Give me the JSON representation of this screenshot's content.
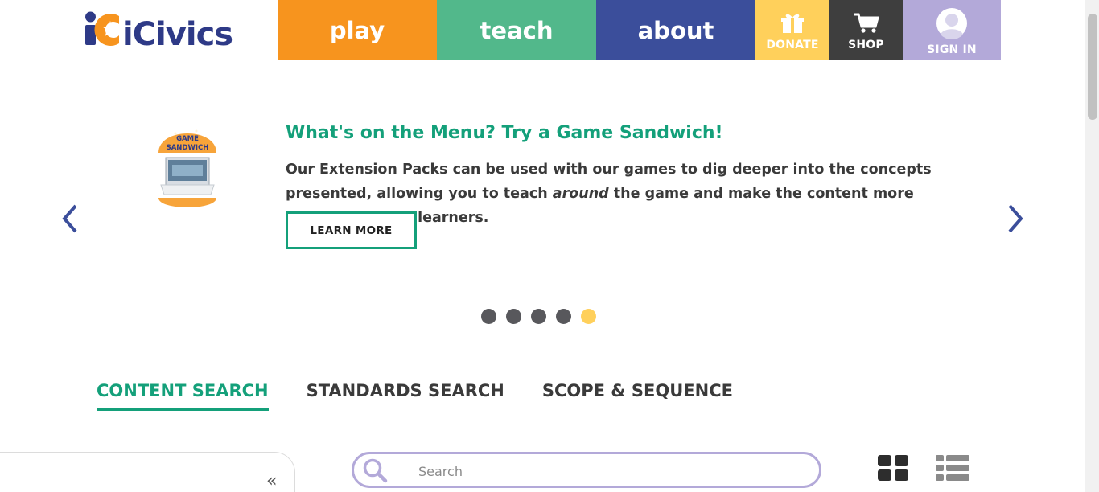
{
  "header": {
    "logo_text": "iCivics",
    "nav": {
      "play": "play",
      "teach": "teach",
      "about": "about",
      "donate": "DONATE",
      "shop": "SHOP",
      "sign_in": "SIGN IN"
    }
  },
  "carousel": {
    "image_caption": "GAME SANDWICH",
    "title": "What's on the Menu? Try a Game Sandwich!",
    "text_part1": "Our Extension Packs can be used with our games to dig deeper into the concepts presented, allowing you to teach ",
    "text_emphasis": "around",
    "text_part2": " the game and make the content more accessible to all learners.",
    "button_label": "LEARN MORE",
    "slide_count": 5,
    "active_slide": 5
  },
  "tabs": [
    {
      "label": "CONTENT SEARCH",
      "active": true
    },
    {
      "label": "STANDARDS SEARCH",
      "active": false
    },
    {
      "label": "SCOPE & SEQUENCE",
      "active": false
    }
  ],
  "search": {
    "placeholder": "Search",
    "value": ""
  },
  "filter_panel": {
    "collapse_symbol": "«"
  },
  "colors": {
    "play": "#f7941e",
    "teach": "#52b88b",
    "about": "#3b4e9b",
    "donate": "#ffd05b",
    "shop": "#3e3e3e",
    "sign_in": "#b3a9d9",
    "accent_green": "#14a07a",
    "logo_blue": "#2e3a87"
  },
  "icons": [
    "gift-icon",
    "cart-icon",
    "user-avatar-icon",
    "chevron-left-icon",
    "chevron-right-icon",
    "search-icon",
    "grid-view-icon",
    "list-view-icon",
    "double-chevron-left-icon"
  ]
}
